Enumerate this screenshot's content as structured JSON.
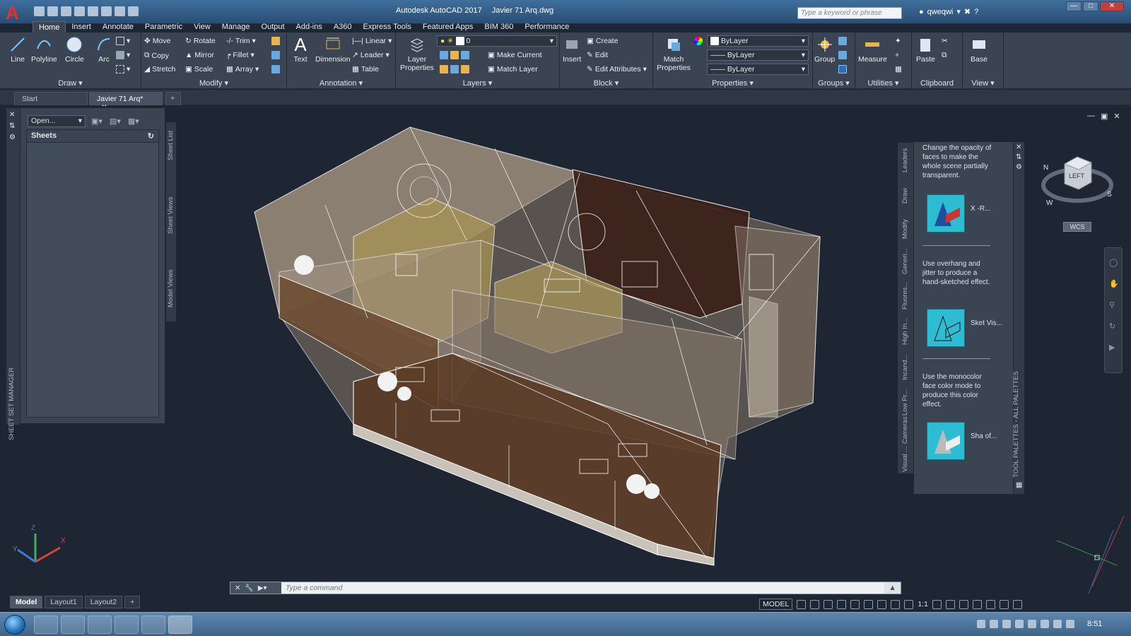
{
  "app": {
    "logo": "A",
    "title": "Autodesk AutoCAD 2017",
    "filename": "Javier 71 Arq.dwg",
    "search_placeholder": "Type a keyword or phrase",
    "user": "qweqwi"
  },
  "ribbon_tabs": [
    "Home",
    "Insert",
    "Annotate",
    "Parametric",
    "View",
    "Manage",
    "Output",
    "Add-ins",
    "A360",
    "Express Tools",
    "Featured Apps",
    "BIM 360",
    "Performance"
  ],
  "panels": {
    "draw": {
      "title": "Draw",
      "line": "Line",
      "polyline": "Polyline",
      "circle": "Circle",
      "arc": "Arc"
    },
    "modify": {
      "title": "Modify",
      "move": "Move",
      "rotate": "Rotate",
      "trim": "Trim",
      "copy": "Copy",
      "mirror": "Mirror",
      "fillet": "Fillet",
      "stretch": "Stretch",
      "scale": "Scale",
      "array": "Array"
    },
    "annotation": {
      "title": "Annotation",
      "text": "Text",
      "dimension": "Dimension",
      "linear": "Linear",
      "leader": "Leader",
      "table": "Table"
    },
    "layers": {
      "title": "Layers",
      "layer_properties": "Layer Properties",
      "make_current": "Make Current",
      "match_layer": "Match Layer",
      "current_layer": "0"
    },
    "block": {
      "title": "Block",
      "insert": "Insert",
      "create": "Create",
      "edit": "Edit",
      "edit_attributes": "Edit Attributes"
    },
    "properties": {
      "title": "Properties",
      "match_properties": "Match Properties",
      "color": "ByLayer",
      "linetype": "ByLayer",
      "lineweight": "ByLayer"
    },
    "groups": {
      "title": "Groups",
      "group": "Group"
    },
    "utilities": {
      "title": "Utilities",
      "measure": "Measure"
    },
    "clipboard": {
      "title": "Clipboard",
      "paste": "Paste"
    },
    "view": {
      "title": "View",
      "base": "Base"
    }
  },
  "doc_tabs": {
    "start": "Start",
    "active": "Javier 71 Arq*"
  },
  "sheet_set": {
    "title": "SHEET SET MANAGER",
    "open": "Open...",
    "sheets": "Sheets",
    "vtabs": [
      "Sheet List",
      "Sheet Views",
      "Model Views"
    ]
  },
  "tool_palette": {
    "title": "TOOL PALETTES - ALL PALETTES",
    "tabs": [
      "Leaders",
      "Draw",
      "Modify",
      "Generi...",
      "Fluores...",
      "High In...",
      "Incand...",
      "Low Pr...",
      "Cameras",
      "Visual ..."
    ],
    "items": [
      {
        "desc": "Change the opacity of faces to make the whole scene partially transparent.",
        "label": "X -R..."
      },
      {
        "desc": "Use overhang and jitter to produce a hand-sketched effect.",
        "label": "Sket Vis..."
      },
      {
        "desc": "Use the monocolor face color mode to produce this color effect.",
        "label": "Sha of..."
      }
    ]
  },
  "viewcube": {
    "face": "LEFT",
    "wcs": "WCS",
    "compass": {
      "n": "N",
      "s": "S",
      "w": "W"
    }
  },
  "command": {
    "placeholder": "Type a command"
  },
  "layout_tabs": [
    "Model",
    "Layout1",
    "Layout2"
  ],
  "status": {
    "model": "MODEL",
    "scale": "1:1"
  },
  "clock": "8:51",
  "colors": {
    "accent": "#3b4452",
    "title_bar": "#2a4e74",
    "viewport": "#1e2633",
    "palette_thumb": "#2dbcd1"
  }
}
